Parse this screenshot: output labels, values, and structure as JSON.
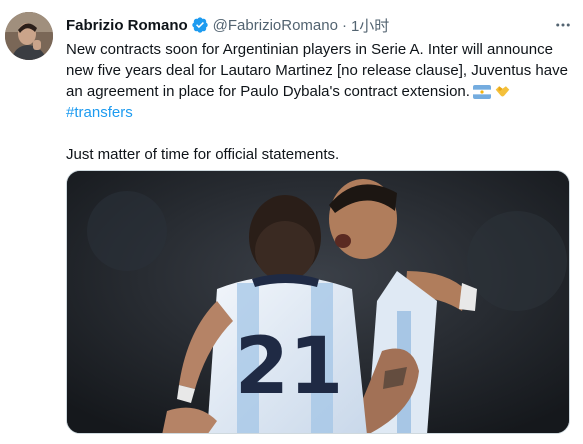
{
  "tweet": {
    "author_name": "Fabrizio Romano",
    "handle": "@FabrizioRomano",
    "separator": "·",
    "time": "1小时",
    "text_lines": [
      "New contracts soon for Argentinian players in Serie A. Inter will announce",
      "new five years deal for Lautaro Martinez [no release clause], Juventus have",
      "an agreement in place for Paulo Dybala's contract extension."
    ],
    "hashtag": "#transfers",
    "closing": "Just matter of time for official statements.",
    "emojis": [
      "argentina-flag",
      "handshake"
    ],
    "media": {
      "jersey_number": "21"
    },
    "verified_badge_color": "#1d9bf0",
    "hashtag_color": "#1d9bf0"
  }
}
